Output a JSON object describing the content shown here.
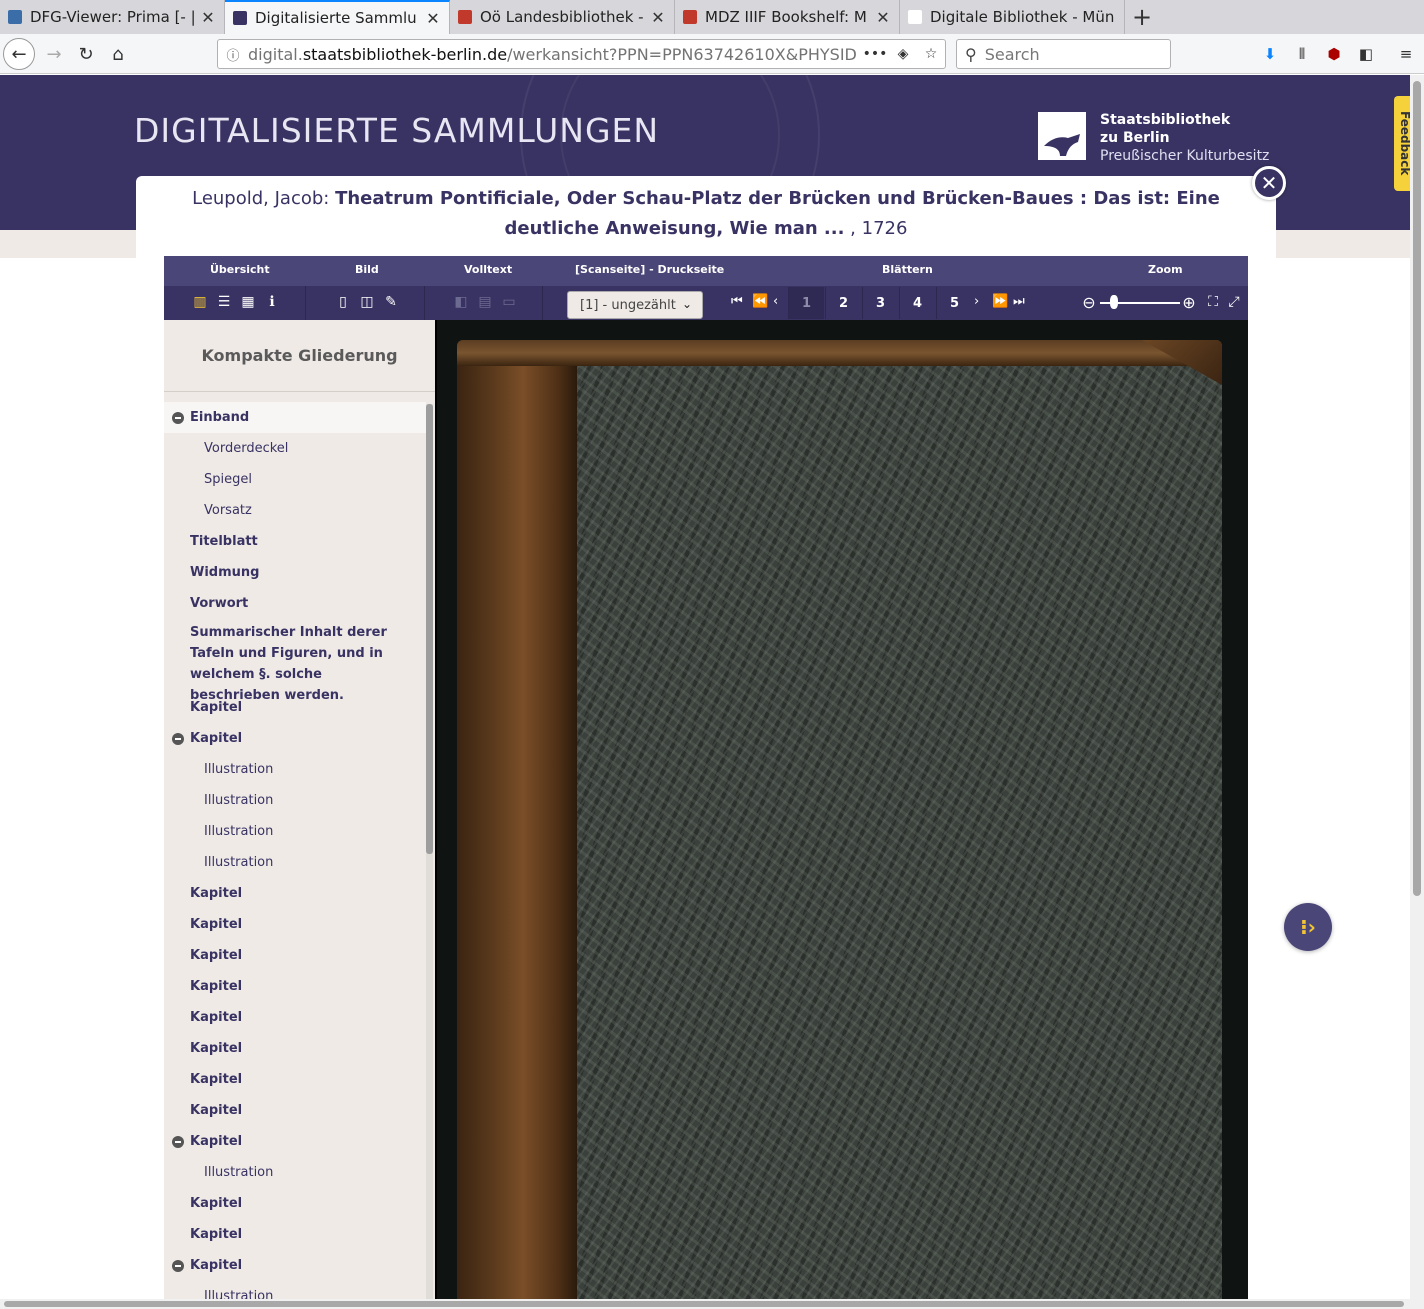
{
  "browser": {
    "tabs": [
      {
        "title": "DFG-Viewer: Prima [- |",
        "favicon_color": "#3b6ea8",
        "active": false
      },
      {
        "title": "Digitalisierte Sammlu",
        "favicon_color": "#393363",
        "active": true
      },
      {
        "title": "Oö Landesbibliothek -",
        "favicon_color": "#c0392b",
        "active": false
      },
      {
        "title": "MDZ IIIF Bookshelf: M",
        "favicon_color": "#c0392b",
        "active": false
      },
      {
        "title": "Digitale Bibliothek - Mün",
        "favicon_color": "#ffffff",
        "active": false
      }
    ],
    "url_prefix": "digital.",
    "url_host": "staatsbibliothek-berlin.de",
    "url_path": "/werkansicht?PPN=PPN63742610X&PHYSID",
    "search_placeholder": "Search"
  },
  "site": {
    "title": "DIGITALISIERTE SAMMLUNGEN",
    "logo_line1": "Staatsbibliothek",
    "logo_line2": "zu Berlin",
    "logo_line3": "Preußischer Kulturbesitz",
    "feedback": "Feedback"
  },
  "work": {
    "author": "Leupold, Jacob:",
    "title": "Theatrum Pontificiale, Oder Schau-Platz der Brücken und Brücken-Baues : Das ist: Eine deutliche Anweisung, Wie man ...",
    "year": ", 1726"
  },
  "toolbar": {
    "labels": {
      "overview": "Übersicht",
      "image": "Bild",
      "fulltext": "Volltext",
      "scanpage": "[Scanseite] - Druckseite",
      "browse": "Blättern",
      "zoom": "Zoom"
    },
    "page_select": "[1] - ungezählt",
    "pages": [
      "1",
      "2",
      "3",
      "4",
      "5"
    ],
    "current_page": "1",
    "zoom_level": 0.18
  },
  "sidebar": {
    "heading": "Kompakte Gliederung",
    "items": [
      {
        "label": "Einband",
        "level": 0,
        "toggle": true,
        "active": true
      },
      {
        "label": "Vorderdeckel",
        "level": 1
      },
      {
        "label": "Spiegel",
        "level": 1
      },
      {
        "label": "Vorsatz",
        "level": 1
      },
      {
        "label": "Titelblatt",
        "level": 0
      },
      {
        "label": "Widmung",
        "level": 0
      },
      {
        "label": "Vorwort",
        "level": 0
      },
      {
        "label": "Summarischer Inhalt derer Tafeln und Figuren, und in welchem §. solche beschrieben werden.",
        "level": 0,
        "multi": true
      },
      {
        "label": "Kapitel",
        "level": 0
      },
      {
        "label": "Kapitel",
        "level": 0,
        "toggle": true
      },
      {
        "label": "Illustration",
        "level": 1
      },
      {
        "label": "Illustration",
        "level": 1
      },
      {
        "label": "Illustration",
        "level": 1
      },
      {
        "label": "Illustration",
        "level": 1
      },
      {
        "label": "Kapitel",
        "level": 0
      },
      {
        "label": "Kapitel",
        "level": 0
      },
      {
        "label": "Kapitel",
        "level": 0
      },
      {
        "label": "Kapitel",
        "level": 0
      },
      {
        "label": "Kapitel",
        "level": 0
      },
      {
        "label": "Kapitel",
        "level": 0
      },
      {
        "label": "Kapitel",
        "level": 0
      },
      {
        "label": "Kapitel",
        "level": 0
      },
      {
        "label": "Kapitel",
        "level": 0,
        "toggle": true
      },
      {
        "label": "Illustration",
        "level": 1
      },
      {
        "label": "Kapitel",
        "level": 0
      },
      {
        "label": "Kapitel",
        "level": 0
      },
      {
        "label": "Kapitel",
        "level": 0,
        "toggle": true
      },
      {
        "label": "Illustration",
        "level": 1
      }
    ]
  }
}
